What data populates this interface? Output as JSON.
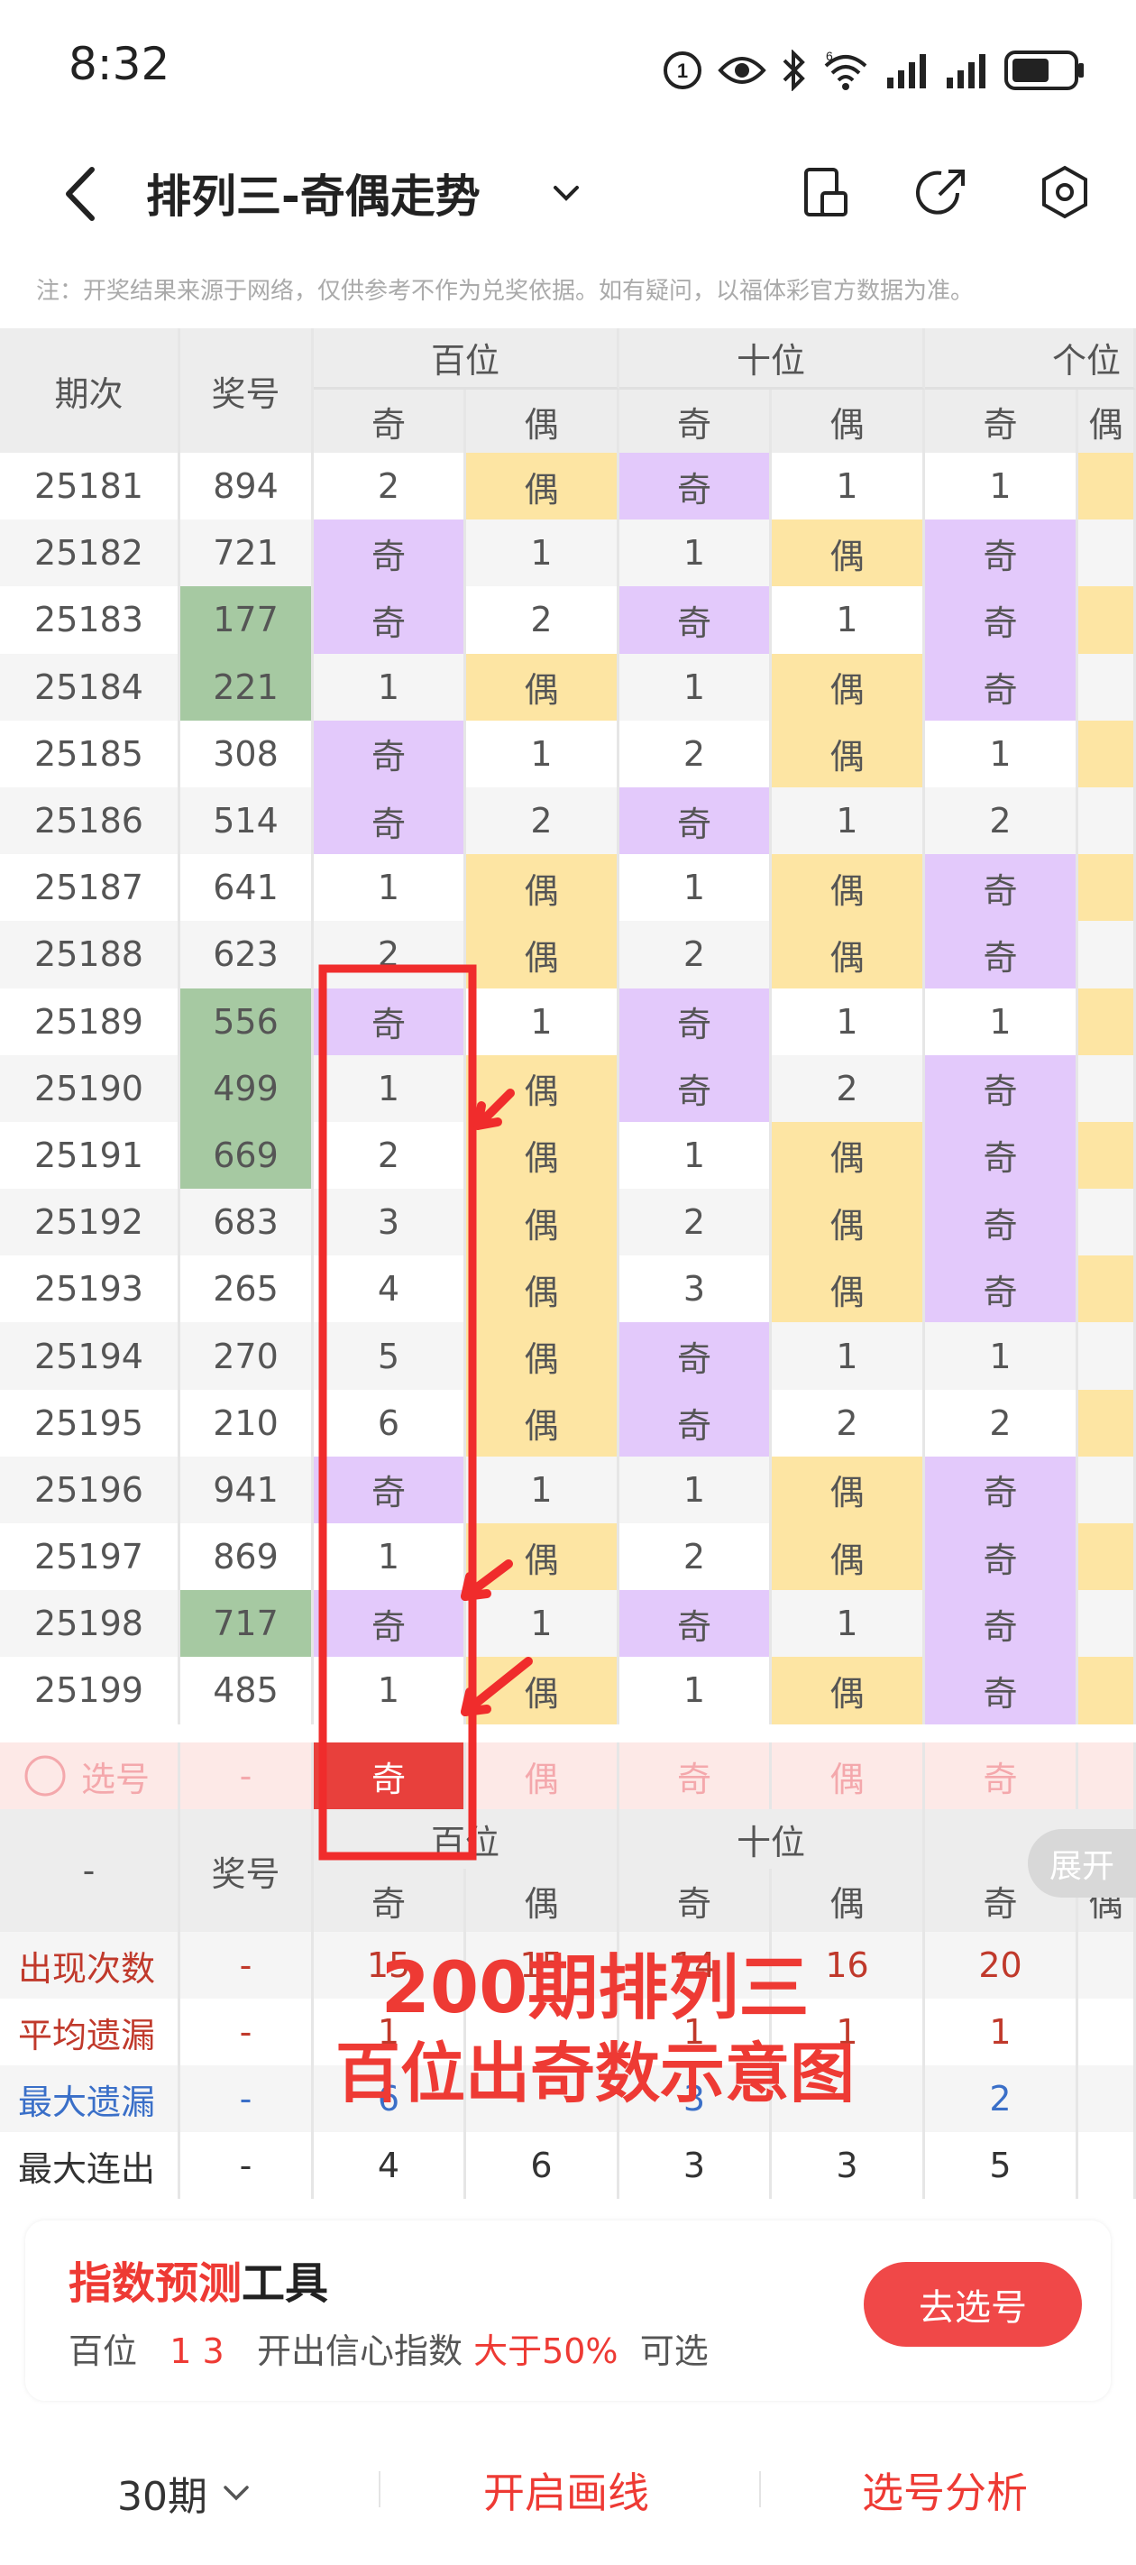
{
  "status_bar": {
    "time": "8:32",
    "network": "6",
    "battery_icon": "battery-icon",
    "signal_icon": "signal-icon",
    "wifi_icon": "wifi-icon"
  },
  "header": {
    "title": "排列三-奇偶走势",
    "back_icon": "back-arrow-icon",
    "dropdown_icon": "chevron-down-icon",
    "action_icons": [
      "phone-rotate-icon",
      "share-icon",
      "settings-icon"
    ]
  },
  "notice": "注：开奖结果来源于网络，仅供参考不作为兑奖依据。如有疑问，以福体彩官方数据为准。",
  "table": {
    "head": {
      "period": "期次",
      "number": "奖号",
      "groups": [
        "百位",
        "十位",
        "个位"
      ],
      "odd": "奇",
      "even": "偶"
    },
    "rows": [
      {
        "p": "25181",
        "n": "894",
        "g": 0,
        "h": [
          "2",
          "偶"
        ],
        "t": [
          "奇",
          "1"
        ],
        "o": [
          "1",
          ""
        ]
      },
      {
        "p": "25182",
        "n": "721",
        "g": 0,
        "h": [
          "奇",
          "1"
        ],
        "t": [
          "1",
          "偶"
        ],
        "o": [
          "奇",
          ""
        ]
      },
      {
        "p": "25183",
        "n": "177",
        "g": 1,
        "h": [
          "奇",
          "2"
        ],
        "t": [
          "奇",
          "1"
        ],
        "o": [
          "奇",
          ""
        ]
      },
      {
        "p": "25184",
        "n": "221",
        "g": 1,
        "h": [
          "1",
          "偶"
        ],
        "t": [
          "1",
          "偶"
        ],
        "o": [
          "奇",
          ""
        ]
      },
      {
        "p": "25185",
        "n": "308",
        "g": 0,
        "h": [
          "奇",
          "1"
        ],
        "t": [
          "2",
          "偶"
        ],
        "o": [
          "1",
          ""
        ]
      },
      {
        "p": "25186",
        "n": "514",
        "g": 0,
        "h": [
          "奇",
          "2"
        ],
        "t": [
          "奇",
          "1"
        ],
        "o": [
          "2",
          ""
        ]
      },
      {
        "p": "25187",
        "n": "641",
        "g": 0,
        "h": [
          "1",
          "偶"
        ],
        "t": [
          "1",
          "偶"
        ],
        "o": [
          "奇",
          ""
        ]
      },
      {
        "p": "25188",
        "n": "623",
        "g": 0,
        "h": [
          "2",
          "偶"
        ],
        "t": [
          "2",
          "偶"
        ],
        "o": [
          "奇",
          ""
        ]
      },
      {
        "p": "25189",
        "n": "556",
        "g": 1,
        "h": [
          "奇",
          "1"
        ],
        "t": [
          "奇",
          "1"
        ],
        "o": [
          "1",
          ""
        ]
      },
      {
        "p": "25190",
        "n": "499",
        "g": 1,
        "h": [
          "1",
          "偶"
        ],
        "t": [
          "奇",
          "2"
        ],
        "o": [
          "奇",
          ""
        ]
      },
      {
        "p": "25191",
        "n": "669",
        "g": 1,
        "h": [
          "2",
          "偶"
        ],
        "t": [
          "1",
          "偶"
        ],
        "o": [
          "奇",
          ""
        ]
      },
      {
        "p": "25192",
        "n": "683",
        "g": 0,
        "h": [
          "3",
          "偶"
        ],
        "t": [
          "2",
          "偶"
        ],
        "o": [
          "奇",
          ""
        ]
      },
      {
        "p": "25193",
        "n": "265",
        "g": 0,
        "h": [
          "4",
          "偶"
        ],
        "t": [
          "3",
          "偶"
        ],
        "o": [
          "奇",
          ""
        ]
      },
      {
        "p": "25194",
        "n": "270",
        "g": 0,
        "h": [
          "5",
          "偶"
        ],
        "t": [
          "奇",
          "1"
        ],
        "o": [
          "1",
          ""
        ]
      },
      {
        "p": "25195",
        "n": "210",
        "g": 0,
        "h": [
          "6",
          "偶"
        ],
        "t": [
          "奇",
          "2"
        ],
        "o": [
          "2",
          ""
        ]
      },
      {
        "p": "25196",
        "n": "941",
        "g": 0,
        "h": [
          "奇",
          "1"
        ],
        "t": [
          "1",
          "偶"
        ],
        "o": [
          "奇",
          ""
        ]
      },
      {
        "p": "25197",
        "n": "869",
        "g": 0,
        "h": [
          "1",
          "偶"
        ],
        "t": [
          "2",
          "偶"
        ],
        "o": [
          "奇",
          ""
        ]
      },
      {
        "p": "25198",
        "n": "717",
        "g": 1,
        "h": [
          "奇",
          "1"
        ],
        "t": [
          "奇",
          "1"
        ],
        "o": [
          "奇",
          ""
        ]
      },
      {
        "p": "25199",
        "n": "485",
        "g": 0,
        "h": [
          "1",
          "偶"
        ],
        "t": [
          "1",
          "偶"
        ],
        "o": [
          "奇",
          ""
        ]
      }
    ],
    "pick_row": {
      "label": "选号",
      "number": "-",
      "cells": [
        "奇",
        "偶",
        "奇",
        "偶",
        "奇"
      ]
    },
    "stats_head": {
      "dash": "-",
      "number": "奖号",
      "groups": [
        "百位",
        "十位",
        "个位"
      ],
      "odd": "奇",
      "even": "偶",
      "expand": "展开"
    },
    "stats": [
      {
        "label": "出现次数",
        "n": "-",
        "v": [
          "15",
          "15",
          "14",
          "16",
          "20"
        ],
        "color": "#c0392b"
      },
      {
        "label": "平均遗漏",
        "n": "-",
        "v": [
          "1",
          "",
          "1",
          "1",
          "1"
        ],
        "color": "#c0392b"
      },
      {
        "label": "最大遗漏",
        "n": "-",
        "v": [
          "6",
          "",
          "3",
          "",
          "2"
        ],
        "color": "#3a6fc8"
      },
      {
        "label": "最大连出",
        "n": "-",
        "v": [
          "4",
          "6",
          "3",
          "3",
          "5"
        ],
        "color": "#333"
      }
    ]
  },
  "overlay": {
    "line1": "200期排列三",
    "line2": "百位出奇数示意图"
  },
  "tool": {
    "title_red": "指数预测",
    "title_black": "工具",
    "pos": "百位",
    "nums": "1 3",
    "desc": "开出信心指数",
    "cond": "大于50%",
    "tail": "可选",
    "button": "去选号"
  },
  "bottom": {
    "period": "30期",
    "draw_line": "开启画线",
    "analysis": "选号分析"
  }
}
